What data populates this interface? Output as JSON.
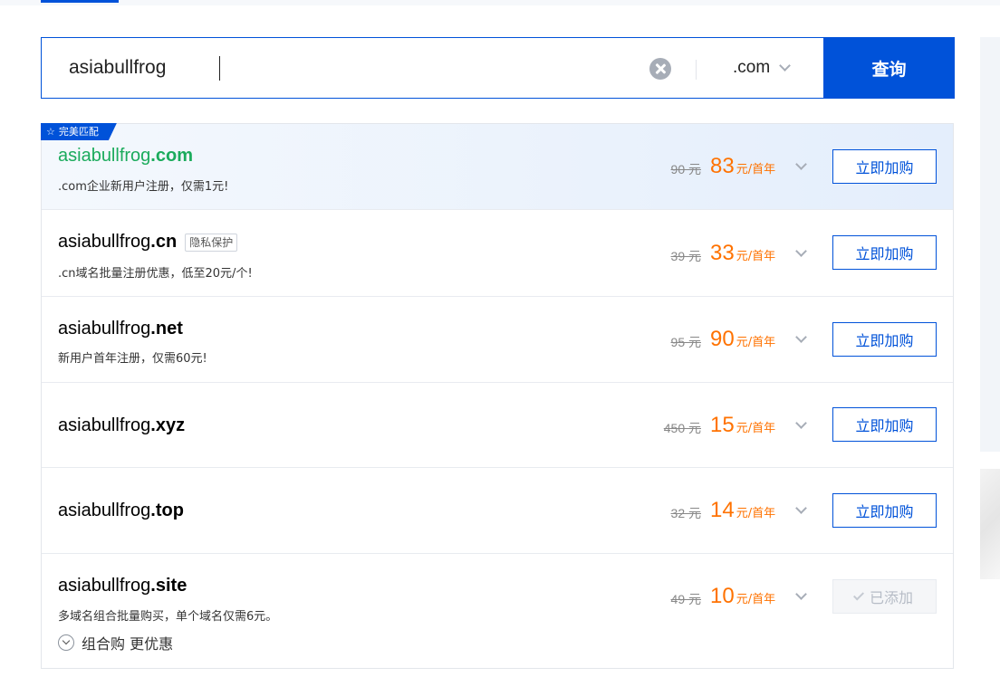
{
  "search": {
    "query": "asiabullfrog",
    "suffix_selected": ".com",
    "button_label": "查询"
  },
  "results": [
    {
      "name": "asiabullfrog",
      "ext": ".com",
      "badge": "完美匹配",
      "tag": "",
      "desc": ".com企业新用户注册，仅需1元!",
      "original_price": "90 元",
      "price": "83",
      "unit": "元/首年",
      "action": "立即加购",
      "added": false
    },
    {
      "name": "asiabullfrog",
      "ext": ".cn",
      "badge": "",
      "tag": "隐私保护",
      "desc": ".cn域名批量注册优惠，低至20元/个!",
      "original_price": "39 元",
      "price": "33",
      "unit": "元/首年",
      "action": "立即加购",
      "added": false
    },
    {
      "name": "asiabullfrog",
      "ext": ".net",
      "badge": "",
      "tag": "",
      "desc": "新用户首年注册，仅需60元!",
      "original_price": "95 元",
      "price": "90",
      "unit": "元/首年",
      "action": "立即加购",
      "added": false
    },
    {
      "name": "asiabullfrog",
      "ext": ".xyz",
      "badge": "",
      "tag": "",
      "desc": "",
      "original_price": "450 元",
      "price": "15",
      "unit": "元/首年",
      "action": "立即加购",
      "added": false
    },
    {
      "name": "asiabullfrog",
      "ext": ".top",
      "badge": "",
      "tag": "",
      "desc": "",
      "original_price": "32 元",
      "price": "14",
      "unit": "元/首年",
      "action": "立即加购",
      "added": false
    },
    {
      "name": "asiabullfrog",
      "ext": ".site",
      "badge": "",
      "tag": "",
      "desc": "多域名组合批量购买，单个域名仅需6元。",
      "original_price": "49 元",
      "price": "10",
      "unit": "元/首年",
      "action": "已添加",
      "added": true
    }
  ],
  "bundle_link": "组合购 更优惠",
  "icons": {
    "clear": "clear-circle-icon",
    "suffix_dropdown": "chevron-down-icon",
    "badge": "star-icon",
    "added": "check-icon",
    "bundle": "circle-chevron-down-icon"
  },
  "colors": {
    "primary": "#0052d9",
    "price": "#ff7200",
    "match_green": "#1bab5c"
  }
}
